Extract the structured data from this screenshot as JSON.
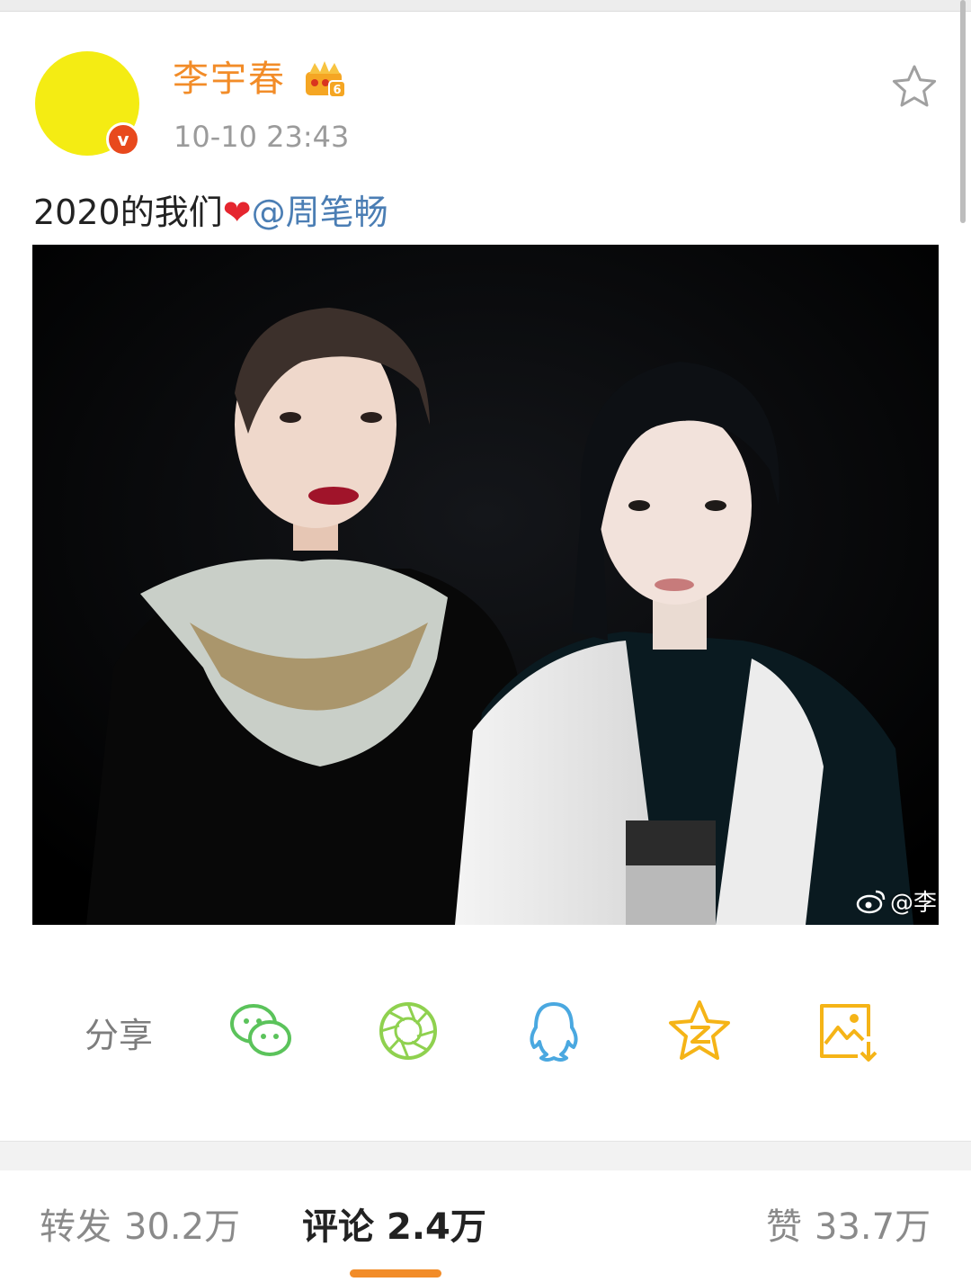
{
  "post": {
    "author": "李宇春",
    "timestamp": "10-10 23:43",
    "text_prefix": "2020的我们",
    "heart": "❤",
    "mention": "@周笔畅"
  },
  "photo": {
    "watermark": "@李"
  },
  "share": {
    "label": "分享",
    "icons": [
      "wechat-icon",
      "moments-icon",
      "qq-icon",
      "qzone-icon",
      "save-image-icon"
    ]
  },
  "tabs": {
    "repost_label": "转发",
    "repost_count": "30.2万",
    "comment_label": "评论",
    "comment_count": "2.4万",
    "like_label": "赞",
    "like_count": "33.7万"
  },
  "colors": {
    "accent": "#f28c28",
    "mention": "#4b7eb4",
    "avatar": "#f4ec13",
    "verified": "#e8491d",
    "wechat": "#5bc35b",
    "moments": "#8fd14f",
    "qq": "#4aa8e0",
    "qzone": "#f5b417"
  }
}
